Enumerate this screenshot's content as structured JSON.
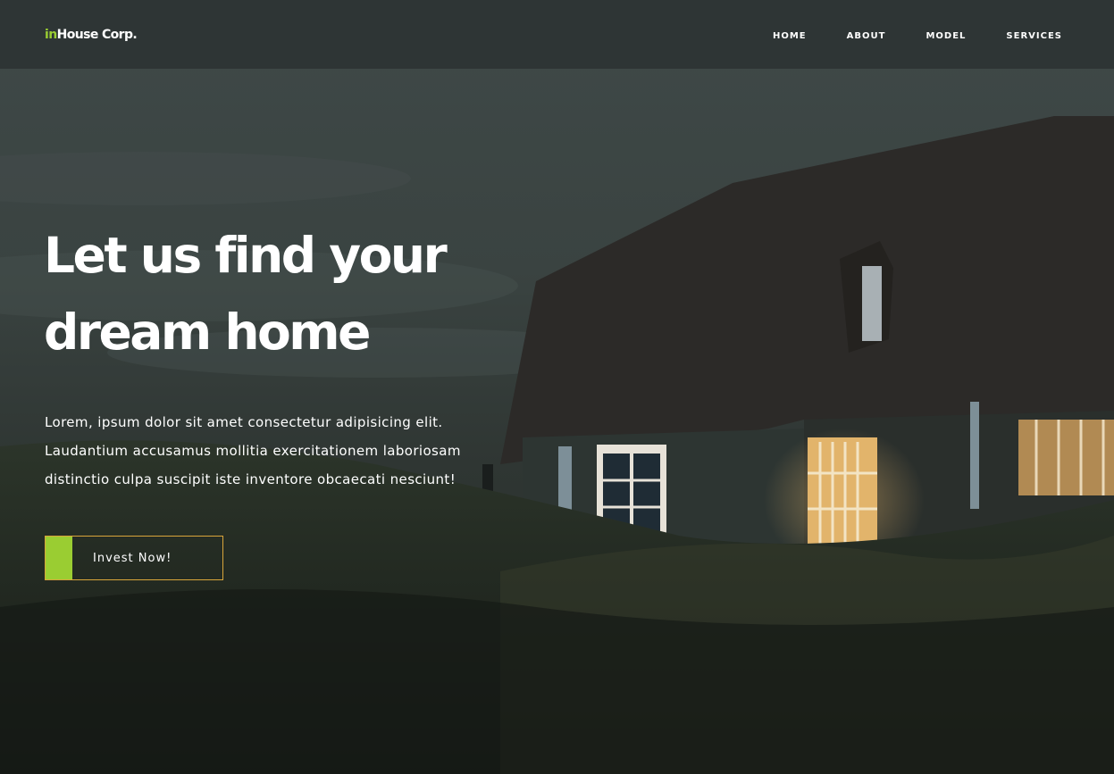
{
  "brand": {
    "prefix": "in",
    "name": "House Corp."
  },
  "nav": {
    "items": [
      {
        "label": "HOME"
      },
      {
        "label": "ABOUT"
      },
      {
        "label": "MODEL"
      },
      {
        "label": "SERVICES"
      }
    ]
  },
  "hero": {
    "headline_line1": "Let us find your",
    "headline_line2": "dream home",
    "lead_line1": "Lorem, ipsum dolor sit amet consectetur adipisicing elit.",
    "lead_line2": "Laudantium accusamus mollitia exercitationem laboriosam",
    "lead_line3": "distinctio culpa suscipit iste inventore obcaecati nesciunt!",
    "cta_label": "Invest Now!"
  },
  "colors": {
    "accent_green": "#9acd32",
    "cta_border": "#d9a53a",
    "text": "#ffffff"
  }
}
